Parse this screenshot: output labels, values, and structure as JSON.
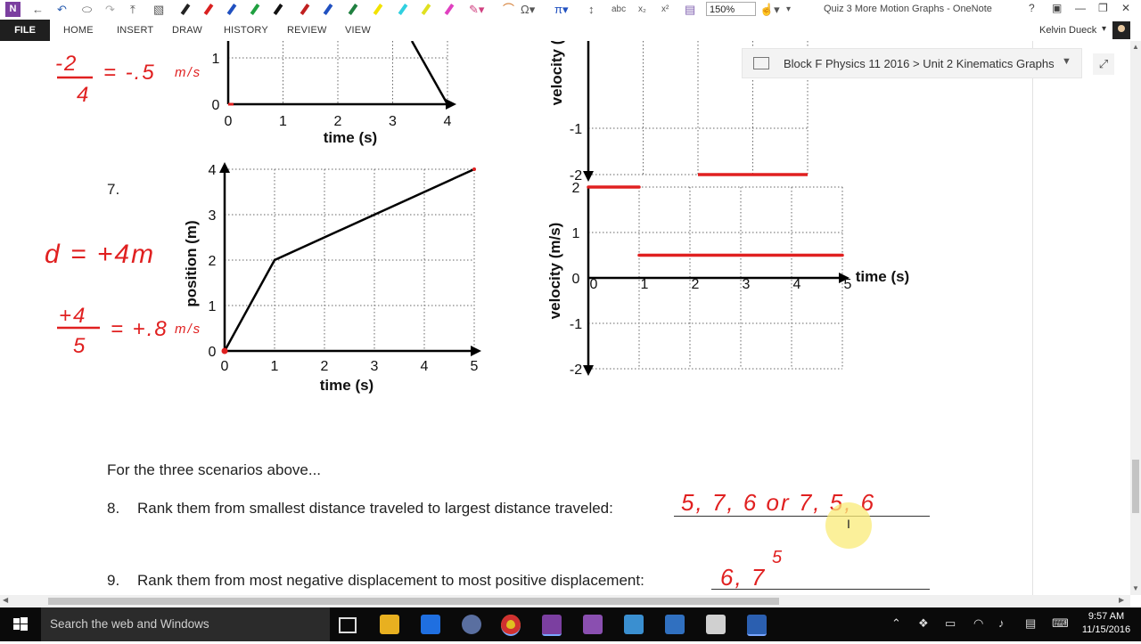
{
  "window": {
    "title": "Quiz 3 More Motion Graphs - OneNote",
    "zoom": "150%",
    "help_label": "?"
  },
  "ribbon": {
    "file": "FILE",
    "tabs": [
      "HOME",
      "INSERT",
      "DRAW",
      "HISTORY",
      "REVIEW",
      "VIEW"
    ],
    "user": "Kelvin Dueck"
  },
  "breadcrumb": {
    "text": "Block F Physics 11 2016 > Unit 2 Kinematics Graphs"
  },
  "page": {
    "q7_number": "7.",
    "intro": "For the three scenarios above...",
    "q8": {
      "number": "8.",
      "text": "Rank them from smallest distance traveled to largest distance traveled:"
    },
    "q9": {
      "number": "9.",
      "text": "Rank them from most negative displacement to most positive displacement:"
    }
  },
  "handwriting": {
    "q6_fraction": {
      "numerator": "-2",
      "denominator": "4",
      "result": "= -.5",
      "units": "m/s"
    },
    "q7_distance": "d = +4m",
    "q7_fraction": {
      "numerator": "+4",
      "denominator": "5",
      "result": "= +.8",
      "units": "m/s"
    },
    "q8_answer": "5, 7, 6 or 7, 5, 6",
    "q9_answer_main": "6, 7",
    "q9_answer_above": "5"
  },
  "chart_data": [
    {
      "id": "q6-position",
      "type": "line",
      "xlabel": "time (s)",
      "ylabel": "",
      "xticks": [
        0,
        1,
        2,
        3,
        4
      ],
      "yticks_visible": [
        0,
        1
      ],
      "note": "partially scrolled off top"
    },
    {
      "id": "q6-velocity",
      "type": "line",
      "ylabel": "velocity (m/s)",
      "yticks_visible": [
        -1,
        -2
      ],
      "series": [
        {
          "values": [
            [
              2,
              -2
            ],
            [
              4,
              -2
            ]
          ],
          "color": "#e02020"
        }
      ],
      "note": "partially scrolled off top"
    },
    {
      "id": "q7-position",
      "type": "line",
      "xlabel": "time (s)",
      "ylabel": "position (m)",
      "xlim": [
        0,
        5
      ],
      "ylim": [
        0,
        4
      ],
      "xticks": [
        0,
        1,
        2,
        3,
        4,
        5
      ],
      "yticks": [
        0,
        1,
        2,
        3,
        4
      ],
      "grid": true,
      "series": [
        {
          "values": [
            [
              0,
              0
            ],
            [
              1,
              2
            ],
            [
              5,
              4
            ]
          ],
          "color": "#000000"
        }
      ]
    },
    {
      "id": "q7-velocity",
      "type": "line",
      "xlabel": "time (s)",
      "ylabel": "velocity (m/s)",
      "xlim": [
        0,
        5
      ],
      "ylim": [
        -2,
        2
      ],
      "xticks": [
        0,
        1,
        2,
        3,
        4,
        5
      ],
      "yticks": [
        2,
        1,
        0,
        -1,
        -2
      ],
      "grid": true,
      "series": [
        {
          "values": [
            [
              0,
              2
            ],
            [
              1,
              2
            ]
          ],
          "color": "#e02020"
        },
        {
          "values": [
            [
              1,
              0.5
            ],
            [
              5,
              0.5
            ]
          ],
          "color": "#e02020"
        }
      ]
    }
  ],
  "taskbar": {
    "search_placeholder": "Search the web and Windows",
    "time": "9:57 AM",
    "date": "11/15/2016"
  }
}
